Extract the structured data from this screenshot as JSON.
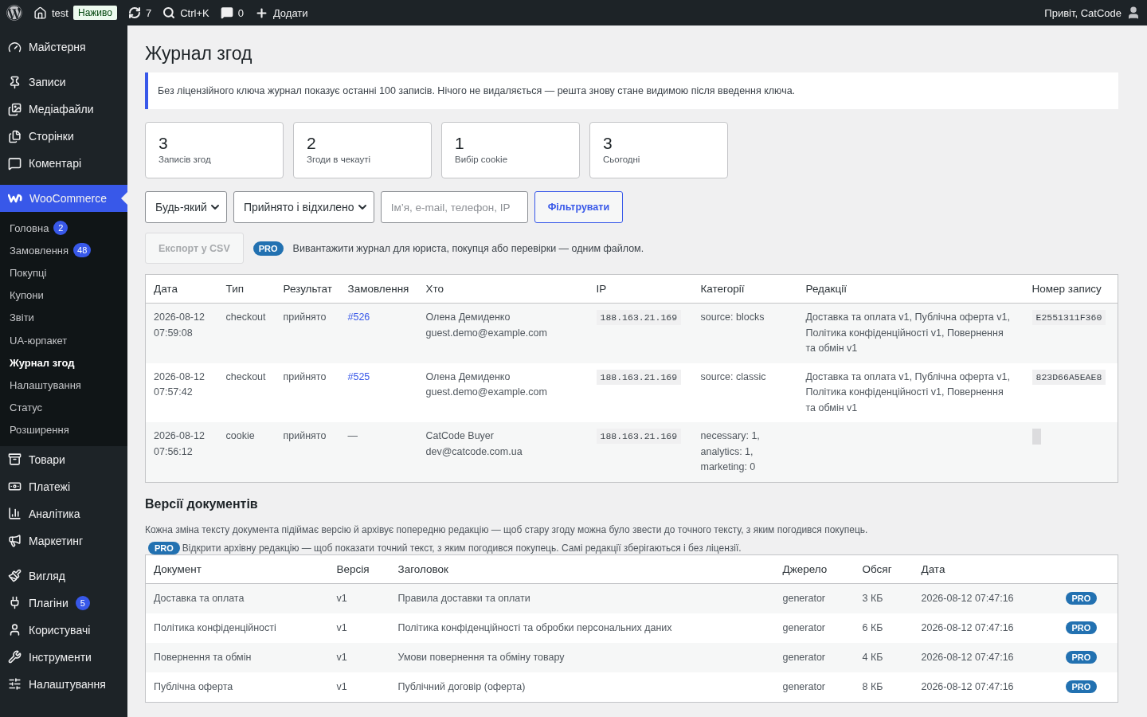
{
  "admin_bar": {
    "site": "test",
    "live_badge": "Наживо",
    "updates": "7",
    "search": "Ctrl+K",
    "comments": "0",
    "add": "Додати",
    "greeting": "Привіт, CatCode"
  },
  "sidebar": {
    "sections": [
      [
        {
          "label": "Майстерня",
          "selected": false
        }
      ],
      [
        {
          "label": "Записи",
          "selected": false
        },
        {
          "label": "Медіафайли",
          "selected": false
        },
        {
          "label": "Сторінки",
          "selected": false
        },
        {
          "label": "Коментарі",
          "selected": false
        }
      ],
      [
        {
          "label": "WooCommerce",
          "selected": true,
          "children": [
            {
              "label": "Головна",
              "badge": "2",
              "selected": false
            },
            {
              "label": "Замовлення",
              "badge": "48",
              "selected": false
            },
            {
              "label": "Покупці",
              "selected": false
            },
            {
              "label": "Купони",
              "selected": false
            },
            {
              "label": "Звіти",
              "selected": false
            },
            {
              "label": "UA-юрпакет",
              "selected": false
            },
            {
              "label": "Журнал згод",
              "selected": true
            },
            {
              "label": "Налаштування",
              "selected": false
            },
            {
              "label": "Статус",
              "selected": false
            },
            {
              "label": "Розширення",
              "selected": false
            }
          ]
        },
        {
          "label": "Товари",
          "selected": false
        },
        {
          "label": "Платежі",
          "selected": false
        },
        {
          "label": "Аналітика",
          "selected": false
        },
        {
          "label": "Маркетинг",
          "selected": false
        }
      ],
      [
        {
          "label": "Вигляд",
          "selected": false
        },
        {
          "label": "Плагіни",
          "badge": "5",
          "selected": false
        },
        {
          "label": "Користувачі",
          "selected": false
        },
        {
          "label": "Інструменти",
          "selected": false
        },
        {
          "label": "Налаштування",
          "selected": false
        }
      ]
    ]
  },
  "page": {
    "title": "Журнал згод",
    "notice": "Без ліцензійного ключа журнал показує останні 100 записів. Нічого не видаляється — решта знову стане видимою після введення ключа.",
    "stats": [
      {
        "value": "3",
        "label": "Записів згод"
      },
      {
        "value": "2",
        "label": "Згоди в чекауті"
      },
      {
        "value": "1",
        "label": "Вибір cookie"
      },
      {
        "value": "3",
        "label": "Сьогодні"
      }
    ],
    "filters": {
      "type_select": "Будь-який",
      "result_select": "Прийнято і відхилено",
      "search": {
        "placeholder": "Ім’я, e-mail, телефон, IP"
      },
      "filter_button": "Фільтрувати"
    },
    "export": {
      "button": "Експорт у CSV",
      "disabled": true,
      "pro_badge": "PRO",
      "hint": "Вивантажити журнал для юриста, покупця або перевірки — одним файлом."
    },
    "consent_table": {
      "columns": [
        "Дата",
        "Тип",
        "Результат",
        "Замовлення",
        "Хто",
        "IP",
        "Категорії",
        "Редакції",
        "Номер запису"
      ],
      "rows": [
        {
          "date": "2026-08-12",
          "time": "07:59:08",
          "type": "checkout",
          "result": "прийнято",
          "order": "#526",
          "name": "Олена Демиденко",
          "email": "guest.demo@example.com",
          "ip": "188.163.21.169",
          "categories": "source: blocks",
          "revisions": "Доставка та оплата v1, Публічна оферта v1, Політика конфіденційності v1, Повернення та обмін v1",
          "record_id": "E2551311F360"
        },
        {
          "date": "2026-08-12",
          "time": "07:57:42",
          "type": "checkout",
          "result": "прийнято",
          "order": "#525",
          "name": "Олена Демиденко",
          "email": "guest.demo@example.com",
          "ip": "188.163.21.169",
          "categories": "source: classic",
          "revisions": "Доставка та оплата v1, Публічна оферта v1, Політика конфіденційності v1, Повернення та обмін v1",
          "record_id": "823D66A5EAE8"
        },
        {
          "date": "2026-08-12",
          "time": "07:56:12",
          "type": "cookie",
          "result": "прийнято",
          "order": "—",
          "name": "CatCode Buyer",
          "email": "dev@catcode.com.ua",
          "ip": "188.163.21.169",
          "categories": "necessary: 1, analytics: 1, marketing: 0"
        }
      ]
    },
    "versions": {
      "heading": "Версії документів",
      "description": "Кожна зміна тексту документа підіймає версію й архівує попередню редакцію — щоб стару згоду можна було звести до точного тексту, з яким погодився покупець.",
      "pro_badge": "PRO",
      "pro_hint": "Відкрити архівну редакцію — щоб показати точний текст, з яким погодився покупець. Самі редакції зберігаються і без ліцензії.",
      "columns": [
        "Документ",
        "Версія",
        "Заголовок",
        "Джерело",
        "Обсяг",
        "Дата"
      ],
      "rows": [
        {
          "document": "Доставка та оплата",
          "version": "v1",
          "title": "Правила доставки та оплати",
          "source": "generator",
          "size": "3 КБ",
          "date": "2026-08-12 07:47:16",
          "badge": "PRO"
        },
        {
          "document": "Політика конфіденційності",
          "version": "v1",
          "title": "Політика конфіденційності та обробки персональних даних",
          "source": "generator",
          "size": "6 КБ",
          "date": "2026-08-12 07:47:16",
          "badge": "PRO"
        },
        {
          "document": "Повернення та обмін",
          "version": "v1",
          "title": "Умови повернення та обміну товару",
          "source": "generator",
          "size": "4 КБ",
          "date": "2026-08-12 07:47:16",
          "badge": "PRO"
        },
        {
          "document": "Публічна оферта",
          "version": "v1",
          "title": "Публічний договір (оферта)",
          "source": "generator",
          "size": "8 КБ",
          "date": "2026-08-12 07:47:16",
          "badge": "PRO"
        }
      ]
    }
  }
}
